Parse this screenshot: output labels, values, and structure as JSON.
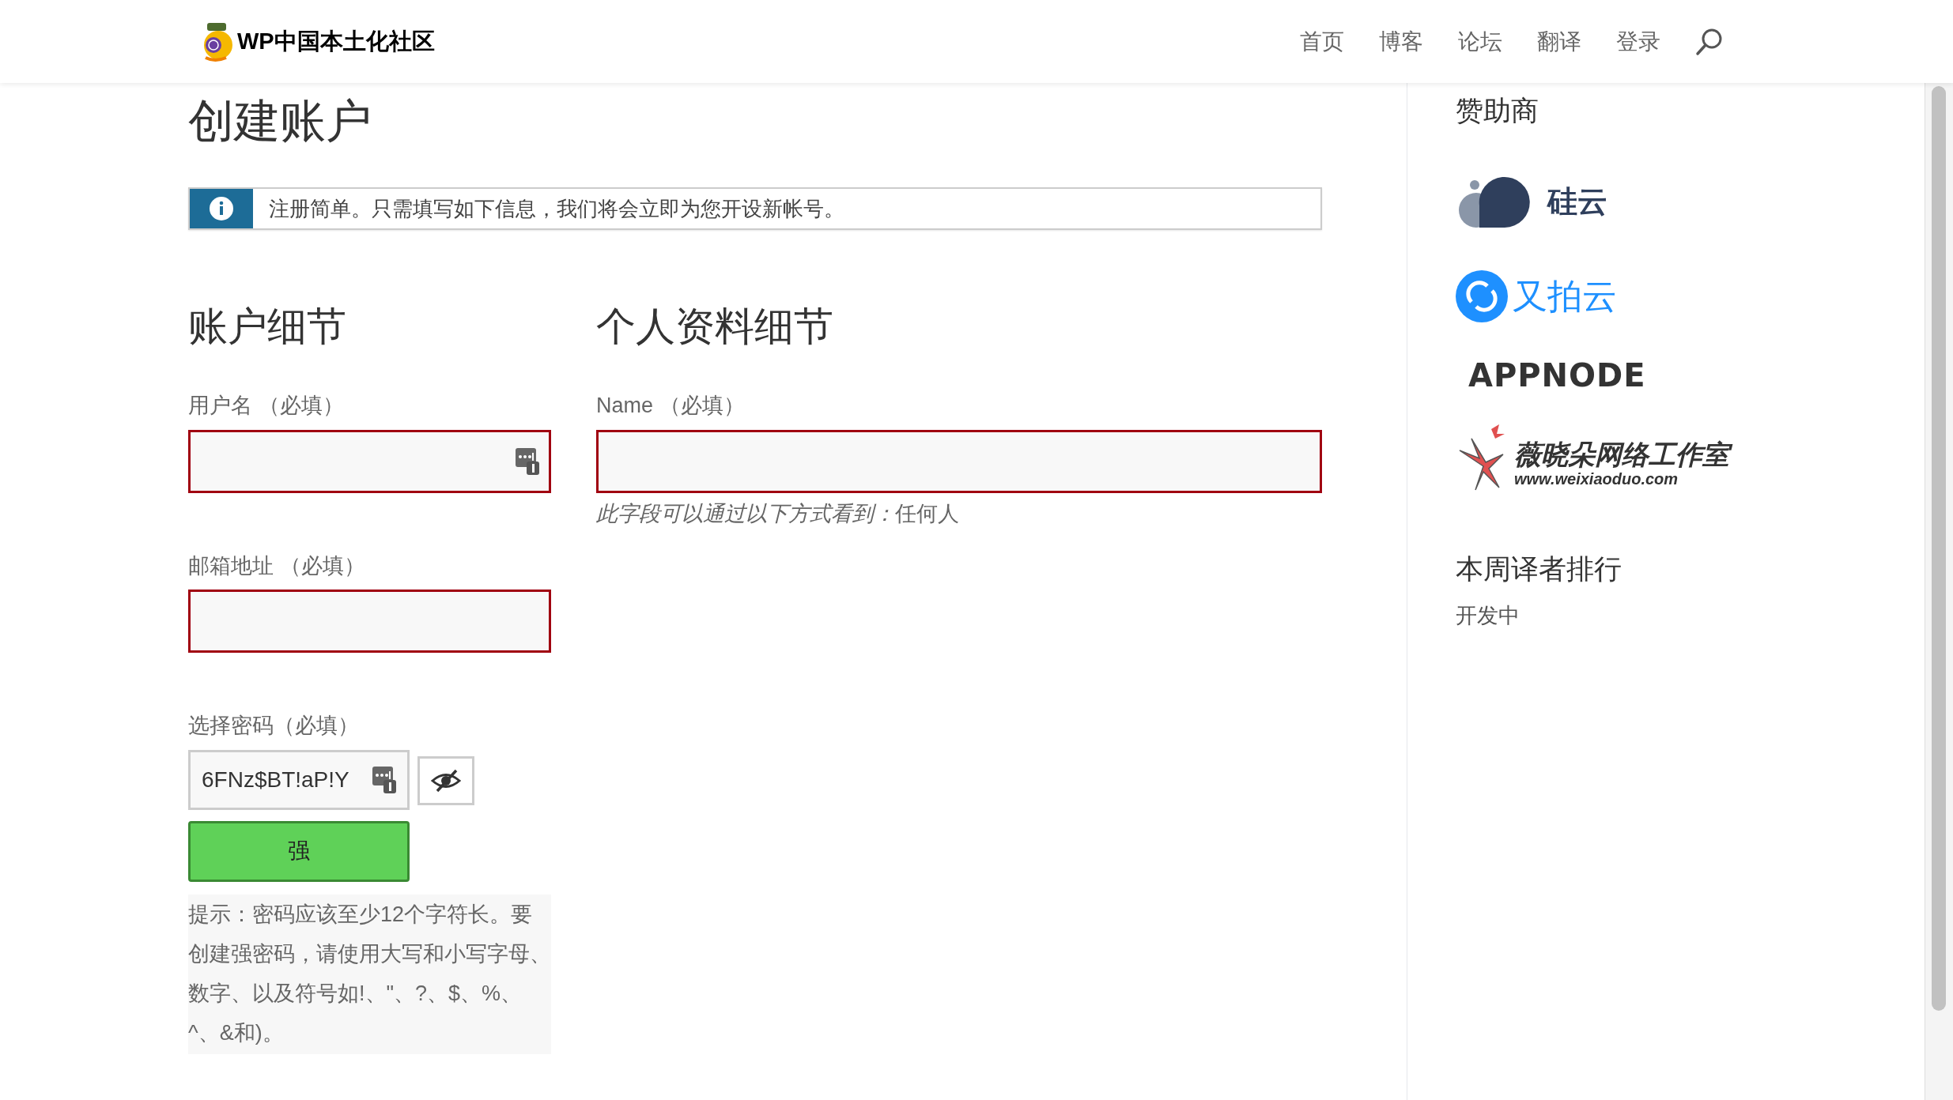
{
  "header": {
    "site_name": "WP中国本土化社区",
    "nav": [
      "首页",
      "博客",
      "论坛",
      "翻译",
      "登录"
    ]
  },
  "page_title": "创建账户",
  "notice": {
    "kind": "info",
    "text": "注册简单。只需填写如下信息，我们将会立即为您开设新帐号。"
  },
  "account_section": {
    "heading": "账户细节",
    "fields": [
      {
        "kind": "text",
        "label": "用户名 （必填）",
        "invalid": true,
        "manager_icon": true
      },
      {
        "kind": "text",
        "label": "邮箱地址 （必填）",
        "invalid": true,
        "manager_icon": false
      },
      {
        "kind": "password",
        "label": "选择密码（必填）",
        "invalid": false,
        "manager_icon": true,
        "value": "6FNz$BT!aP!Y",
        "strength": {
          "label": "强",
          "kind": "strong"
        },
        "hint": "提示：密码应该至少12个字符长。要创建强密码，请使用大写和小写字母、数字、以及符号如!、\"、?、$、%、^、&和)。"
      }
    ]
  },
  "profile_section": {
    "heading": "个人资料细节",
    "fields": [
      {
        "kind": "text",
        "label": "Name （必填）",
        "invalid": true,
        "note": "此字段可以通过以下方式看到：",
        "visibility": "任何人"
      }
    ]
  },
  "sidebar": {
    "sponsors_title": "赞助商",
    "sponsors": [
      {
        "kind": "guiyun",
        "text": "硅云"
      },
      {
        "kind": "upyun",
        "text": "又拍云"
      },
      {
        "kind": "appnode",
        "text": "APPNODE"
      },
      {
        "kind": "weixiaoduo",
        "text": "薇晓朵网络工作室",
        "subtext": "www.weixiaoduo.com"
      }
    ],
    "ranking_title": "本周译者排行",
    "ranking_text": "开发中"
  }
}
